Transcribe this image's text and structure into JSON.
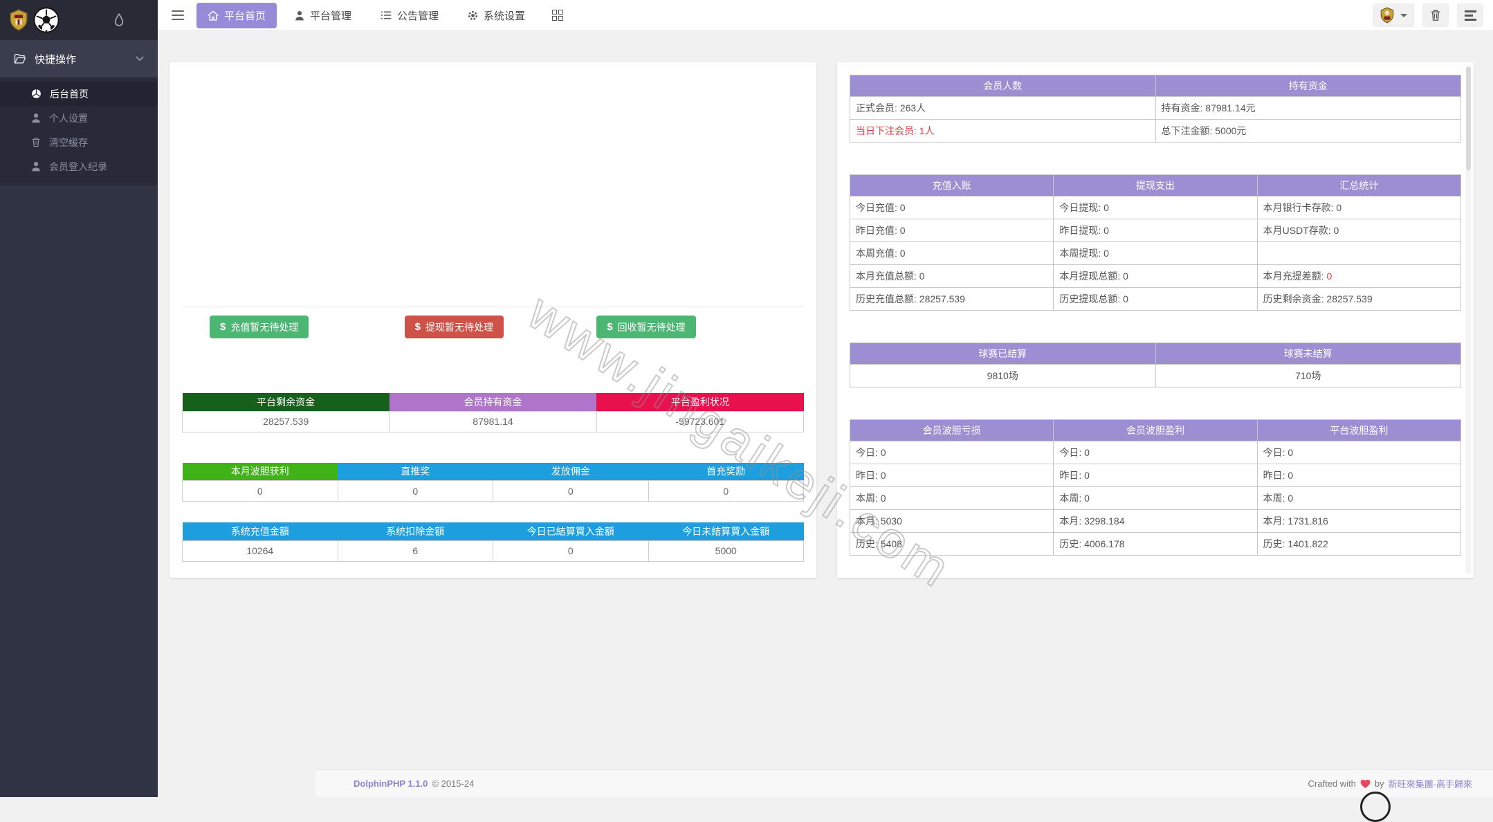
{
  "sidebar": {
    "group_title": "快捷操作",
    "items": [
      {
        "label": "后台首页",
        "active": true
      },
      {
        "label": "个人设置",
        "active": false
      },
      {
        "label": "清空缓存",
        "active": false
      },
      {
        "label": "会员登入纪录",
        "active": false
      }
    ]
  },
  "navbar": {
    "tabs": [
      {
        "label": "平台首页",
        "active": true
      },
      {
        "label": "平台管理",
        "active": false
      },
      {
        "label": "公告管理",
        "active": false
      },
      {
        "label": "系统设置",
        "active": false
      }
    ]
  },
  "left_card": {
    "buttons": [
      {
        "dollar": "$",
        "label": "充值暂无待处理",
        "color": "#4cb673"
      },
      {
        "dollar": "$",
        "label": "提现暂无待处理",
        "color": "#cf5248"
      },
      {
        "dollar": "$",
        "label": "回收暂无待处理",
        "color": "#4cb673"
      }
    ],
    "tables": [
      {
        "headers": [
          {
            "text": "平台剩余资金",
            "bg": "#15611b"
          },
          {
            "text": "会员持有资金",
            "bg": "#b074ca"
          },
          {
            "text": "平台盈利状况",
            "bg": "#e9104e"
          }
        ],
        "values": [
          "28257.539",
          "87981.14",
          "-59723.601"
        ]
      },
      {
        "headers": [
          {
            "text": "本月波胆获利",
            "bg": "#3eb217"
          },
          {
            "text": "直推奖",
            "bg": "#1d9fdf"
          },
          {
            "text": "发放佣金",
            "bg": "#1d9fdf"
          },
          {
            "text": "首充奖励",
            "bg": "#1d9fdf"
          }
        ],
        "values": [
          "0",
          "0",
          "0",
          "0"
        ]
      },
      {
        "headers": [
          {
            "text": "系统充值金額",
            "bg": "#1d9fdf"
          },
          {
            "text": "系统扣除金額",
            "bg": "#1d9fdf"
          },
          {
            "text": "今日已結算買入金額",
            "bg": "#1d9fdf"
          },
          {
            "text": "今日未結算買入金額",
            "bg": "#1d9fdf"
          }
        ],
        "values": [
          "10264",
          "6",
          "0",
          "5000"
        ]
      }
    ]
  },
  "right_card": {
    "tables": [
      {
        "name": "members-funds",
        "centered": false,
        "headers": [
          "会员人数",
          "持有资金"
        ],
        "rows": [
          [
            {
              "text": "正式会员: 263人"
            },
            {
              "text": "持有资金: 87981.14元"
            }
          ],
          [
            {
              "text": "当日下注会员: 1人",
              "red": true
            },
            {
              "text": "总下注金额: 5000元"
            }
          ]
        ]
      },
      {
        "name": "deposit-withdraw-summary",
        "centered": false,
        "headers": [
          "充值入账",
          "提现支出",
          "汇总统计"
        ],
        "rows": [
          [
            {
              "text": "今日充值: 0"
            },
            {
              "text": "今日提现: 0"
            },
            {
              "text": "本月银行卡存款: 0"
            }
          ],
          [
            {
              "text": "昨日充值: 0"
            },
            {
              "text": "昨日提现: 0"
            },
            {
              "text": "本月USDT存款: 0"
            }
          ],
          [
            {
              "text": "本周充值: 0"
            },
            {
              "text": "本周提现: 0"
            },
            {
              "text": ""
            }
          ],
          [
            {
              "text": "本月充值总额: 0"
            },
            {
              "text": "本月提现总额: 0"
            },
            {
              "text": "本月充提差额: ",
              "suffix": "0",
              "suffix_red": true
            }
          ],
          [
            {
              "text": "历史充值总额: 28257.539"
            },
            {
              "text": "历史提现总额: 0"
            },
            {
              "text": "历史剩余资金: 28257.539"
            }
          ]
        ]
      },
      {
        "name": "matches-settlement",
        "centered": true,
        "headers": [
          "球赛已结算",
          "球赛未结算"
        ],
        "rows": [
          [
            {
              "text": "9810场"
            },
            {
              "text": "710场"
            }
          ]
        ]
      },
      {
        "name": "bodan-profit-loss",
        "centered": false,
        "headers": [
          "会员波胆亏损",
          "会员波胆盈利",
          "平台波胆盈利"
        ],
        "rows": [
          [
            {
              "text": "今日: 0"
            },
            {
              "text": "今日: 0"
            },
            {
              "text": "今日: 0"
            }
          ],
          [
            {
              "text": "昨日: 0"
            },
            {
              "text": "昨日: 0"
            },
            {
              "text": "昨日: 0"
            }
          ],
          [
            {
              "text": "本周: 0"
            },
            {
              "text": "本周: 0"
            },
            {
              "text": "本周: 0"
            }
          ],
          [
            {
              "text": "本月: 5030"
            },
            {
              "text": "本月: 3298.184"
            },
            {
              "text": "本月: 1731.816"
            }
          ],
          [
            {
              "text": "历史: 5408"
            },
            {
              "text": "历史: 4006.178"
            },
            {
              "text": "历史: 1401.822"
            }
          ]
        ]
      }
    ]
  },
  "watermark": "www.jingaikeji.com",
  "footer": {
    "brand": "DolphinPHP 1.1.0",
    "copyright": "© 2015-24",
    "crafted_pre": "Crafted with",
    "crafted_mid": "by",
    "crafted_link": "新旺來集團-高手歸來"
  },
  "colors": {
    "accent_purple": "#978ad9",
    "table_header_purple": "#9d8dd3",
    "green_button": "#4cb673",
    "red_button": "#cf5248",
    "red_text": "#e03e3e"
  }
}
